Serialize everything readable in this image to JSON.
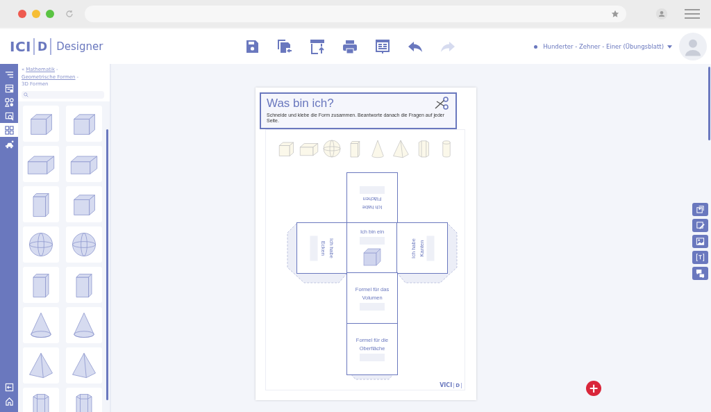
{
  "browser": {
    "dots": [
      {
        "color": "#ee5a4f"
      },
      {
        "color": "#f6be35"
      },
      {
        "color": "#5ac342"
      }
    ]
  },
  "header": {
    "logo": {
      "left": "ICI",
      "mark": "D",
      "product": "Designer"
    },
    "toolbar": [
      {
        "kind": "save",
        "disabled": false
      },
      {
        "kind": "save-as",
        "disabled": false
      },
      {
        "kind": "publish",
        "disabled": false
      },
      {
        "kind": "print",
        "disabled": false
      },
      {
        "kind": "present",
        "disabled": false
      },
      {
        "kind": "undo",
        "disabled": false
      },
      {
        "kind": "redo",
        "disabled": true
      }
    ],
    "document_title": "Hunderter - Zehner - Einer (Übungsblatt)"
  },
  "rail": {
    "items": [
      {
        "kind": "menu",
        "selected": false
      },
      {
        "kind": "templates",
        "selected": false
      },
      {
        "kind": "shapes",
        "selected": false
      },
      {
        "kind": "search-page",
        "selected": false
      },
      {
        "kind": "grid",
        "selected": true
      },
      {
        "kind": "vehicle",
        "selected": false
      }
    ],
    "bottom": [
      {
        "kind": "exit"
      },
      {
        "kind": "home"
      }
    ]
  },
  "panel": {
    "back": "«",
    "separator": "-",
    "breadcrumb": [
      {
        "label": "Mathematik",
        "link": true
      },
      {
        "label": "Geometrische Formen",
        "link": true
      },
      {
        "label": "3D Formen",
        "link": false
      }
    ],
    "shapes": [
      {
        "kind": "cube"
      },
      {
        "kind": "cube"
      },
      {
        "kind": "cuboid"
      },
      {
        "kind": "cuboid"
      },
      {
        "kind": "prism"
      },
      {
        "kind": "cube"
      },
      {
        "kind": "sphere"
      },
      {
        "kind": "sphere"
      },
      {
        "kind": "prism"
      },
      {
        "kind": "prism"
      },
      {
        "kind": "cone"
      },
      {
        "kind": "cone"
      },
      {
        "kind": "pyramid"
      },
      {
        "kind": "pyramid"
      },
      {
        "kind": "hexagonal-prism"
      },
      {
        "kind": "hexagonal-prism"
      }
    ]
  },
  "worksheet": {
    "title": "Was bin ich?",
    "instruction": "Schneide und klebe die Form zusammen. Beantworte danach die Fragen auf jeder Seite.",
    "shape_row": [
      {
        "kind": "cube"
      },
      {
        "kind": "cuboid"
      },
      {
        "kind": "sphere"
      },
      {
        "kind": "prism"
      },
      {
        "kind": "cone"
      },
      {
        "kind": "pyramid"
      },
      {
        "kind": "hexagonal-prism"
      },
      {
        "kind": "cylinder"
      }
    ],
    "net": {
      "top": [
        "Ich habe",
        "Flächen"
      ],
      "left": [
        "Ich habe",
        "Ecken"
      ],
      "center": [
        "Ich bin ein"
      ],
      "right": [
        "Ich habe",
        "Kanten"
      ],
      "bottom": [
        "Formel für das",
        "Volumen"
      ],
      "base": [
        "Formel für die",
        "Oberfläche"
      ]
    },
    "footer_logo": {
      "left": "VICI",
      "mark": "D"
    }
  },
  "right_tools": [
    {
      "kind": "import"
    },
    {
      "kind": "edit"
    },
    {
      "kind": "image"
    },
    {
      "kind": "text"
    },
    {
      "kind": "comment"
    }
  ],
  "add_button": {
    "label": "+"
  }
}
